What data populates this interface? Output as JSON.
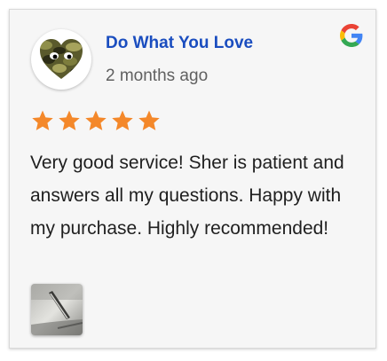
{
  "review": {
    "author": "Do What You Love",
    "time_ago": "2 months ago",
    "rating": 5,
    "text": "Very good service! Sher is patient and answers all my questions. Happy with my purchase. Highly recommended!",
    "source_icon": "google-g-icon",
    "avatar_icon": "camo-heart-icon",
    "photo": "review-photo-thumbnail"
  },
  "colors": {
    "author": "#1a4dbf",
    "star": "#f4882a",
    "text": "#1f1f1f",
    "time": "#606060",
    "card_bg": "#f6f6f6"
  }
}
